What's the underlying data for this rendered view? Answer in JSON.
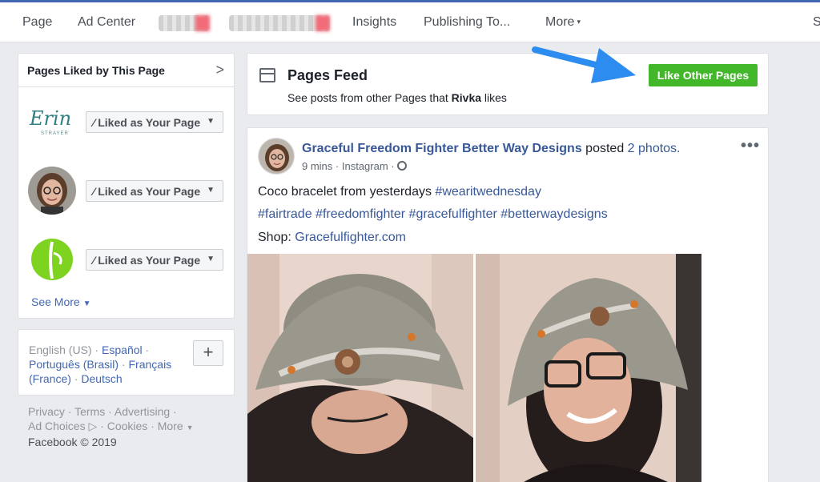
{
  "nav": {
    "items": [
      "Page",
      "Ad Center",
      "Insights",
      "Publishing To...",
      "More"
    ],
    "more_caret": "▾",
    "partial": "S"
  },
  "liked_card": {
    "title": "Pages Liked by This Page",
    "chevron": ">",
    "button_label": "Liked as Your Page",
    "rows": [
      {
        "logo": "erin-strayer-logo",
        "logo_text": "Erin",
        "logo_sub": "STRAYER"
      },
      {
        "logo": "woman-avatar"
      },
      {
        "logo": "green-leaf-logo"
      }
    ],
    "see_more": "See More"
  },
  "lang_card": {
    "current": "English (US)",
    "options": [
      "Español",
      "Português (Brasil)",
      "Français (France)",
      "Deutsch"
    ],
    "add_label": "+"
  },
  "footer": {
    "links": [
      "Privacy",
      "Terms",
      "Advertising",
      "Ad Choices",
      "Cookies",
      "More"
    ],
    "copyright": "Facebook © 2019"
  },
  "feed": {
    "title": "Pages Feed",
    "subtitle_pre": "See posts from other Pages that ",
    "subtitle_name": "Rivka",
    "subtitle_post": " likes",
    "like_other_button": "Like Other Pages"
  },
  "post": {
    "author": "Graceful Freedom Fighter Better Way Designs",
    "action": "posted",
    "photos_link": "2 photos.",
    "time": "9 mins",
    "source": "Instagram",
    "menu": "•••",
    "line1": "Coco bracelet from yesterdays ",
    "line1_tag": "#wearitwednesday",
    "tags": "#fairtrade #freedomfighter #gracefulfighter #betterwaydesigns",
    "shop_label": "Shop: ",
    "shop_link": "Gracefulfighter.com"
  },
  "colors": {
    "brand": "#4267b2",
    "link": "#385898",
    "like_green": "#42b72a",
    "arrow_blue": "#2d8cf0"
  }
}
